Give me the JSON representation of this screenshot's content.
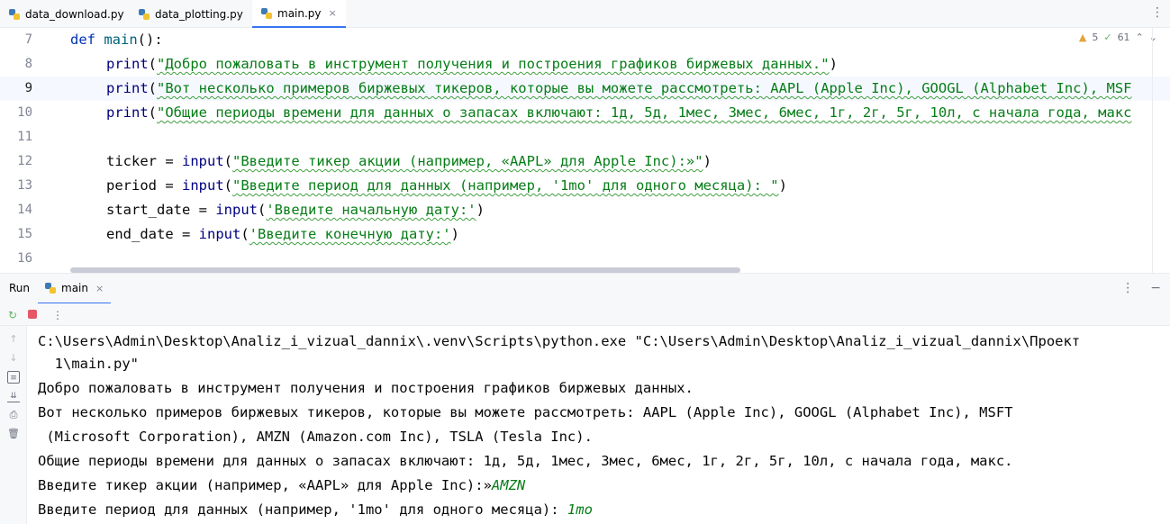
{
  "tabs": [
    {
      "label": "data_download.py"
    },
    {
      "label": "data_plotting.py"
    },
    {
      "label": "main.py",
      "close": "×"
    }
  ],
  "tabbar_more": "⋮",
  "indicators": {
    "warnings": "5",
    "checks": "61"
  },
  "editor": {
    "line_numbers": [
      "7",
      "8",
      "9",
      "10",
      "11",
      "12",
      "13",
      "14",
      "15",
      "16"
    ],
    "lines": {
      "l7_def": "def",
      "l7_main": "main",
      "l7_rest": "():",
      "print_kw": "print",
      "l8_str": "\"Добро пожаловать в инструмент получения и построения графиков биржевых данных.\"",
      "l9_str": "\"Вот несколько примеров биржевых тикеров, которые вы можете рассмотреть: AAPL (Apple Inc), GOOGL (Alphabet Inc), MSF",
      "l10_str": "\"Общие периоды времени для данных о запасах включают: 1д, 5д, 1мес, 3мес, 6мес, 1г, 2г, 5г, 10л, с начала года, макс",
      "l12_var": "ticker = ",
      "input_kw": "input",
      "l12_str": "\"Введите тикер акции (например, «AAPL» для Apple Inc):»\"",
      "l13_var": "period = ",
      "l13_str": "\"Введите период для данных (например, '1mo' для одного месяца): \"",
      "l14_var": "start_date = ",
      "l14_str": "'Введите начальную дату:'",
      "l15_var": "end_date = ",
      "l15_str": "'Введите конечную дату:'"
    }
  },
  "run_panel": {
    "label": "Run",
    "tab": "main",
    "close": "×",
    "more": "⋮",
    "minimize": "−"
  },
  "console": {
    "cmd1": "C:\\Users\\Admin\\Desktop\\Analiz_i_vizual_dannix\\.venv\\Scripts\\python.exe \"C:\\Users\\Admin\\Desktop\\Analiz_i_vizual_dannix\\Проект",
    "cmd2": "  1\\main.py\"",
    "out1": "Добро пожаловать в инструмент получения и построения графиков биржевых данных.",
    "out2": "Вот несколько примеров биржевых тикеров, которые вы можете рассмотреть: AAPL (Apple Inc), GOOGL (Alphabet Inc), MSFT",
    "out3": " (Microsoft Corporation), AMZN (Amazon.com Inc), TSLA (Tesla Inc).",
    "out4": "Общие периоды времени для данных о запасах включают: 1д, 5д, 1мес, 3мес, 6мес, 1г, 2г, 5г, 10л, с начала года, макс.",
    "prompt1": "Введите тикер акции (например, «AAPL» для Apple Inc):»",
    "input1": "AMZN",
    "prompt2": "Введите период для данных (например, '1mo' для одного месяца): ",
    "input2": "1mo"
  }
}
